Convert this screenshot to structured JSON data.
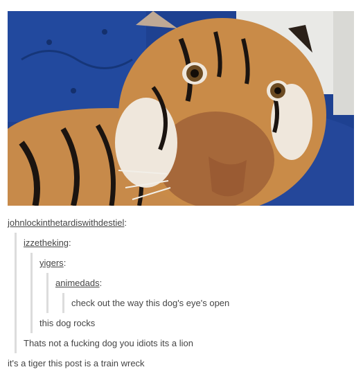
{
  "post": {
    "image": {
      "subject": "tiger-photo",
      "colors": {
        "sofa": "#1e4191",
        "fur": "#c78a4a",
        "stripes": "#1b1410",
        "curtain": "#e9e9e6"
      }
    },
    "thread": [
      {
        "user": "johnlockinthetardiswithdestiel",
        "sep": ":"
      },
      {
        "user": "izzetheking",
        "sep": ":"
      },
      {
        "user": "yigers",
        "sep": ":"
      },
      {
        "user": "animedads",
        "sep": ":"
      },
      {
        "text": "check out the way this dog's eye's open"
      },
      {
        "text": "this dog rocks"
      },
      {
        "text": "Thats not a fucking dog you idiots its a lion"
      },
      {
        "text": "it's a tiger this post is a train wreck"
      }
    ]
  }
}
